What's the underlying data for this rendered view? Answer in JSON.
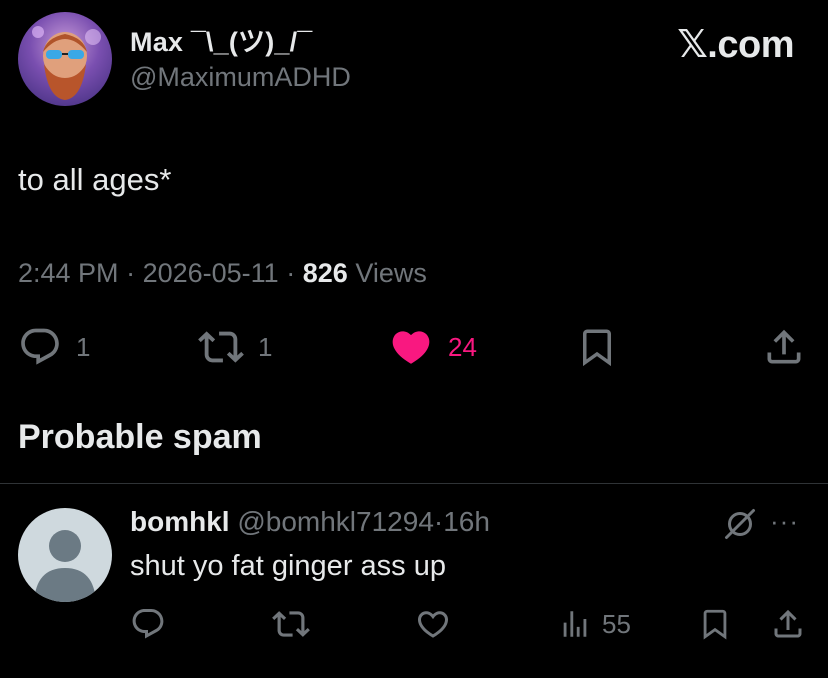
{
  "author": {
    "name": "Max ¯\\_(ツ)_/¯",
    "handle": "@MaximumADHD"
  },
  "brand": "𝕏.com",
  "tweet": {
    "text": "to all ages*",
    "time": "2:44 PM",
    "date": "2026-05-11",
    "views_count": "826",
    "views_label": "Views",
    "sep": "·",
    "replies": "1",
    "reposts": "1",
    "likes": "24"
  },
  "section": {
    "title": "Probable spam"
  },
  "reply": {
    "name": "bomhkl",
    "handle": "@bomhkl71294",
    "sep": "·",
    "age": "16h",
    "text": "shut yo fat ginger ass up",
    "views": "55",
    "more": "···"
  },
  "colors": {
    "like": "#f91880",
    "muted": "#71767b",
    "text": "#e7e9ea",
    "background": "#000000"
  },
  "icons": [
    "reply-icon",
    "repost-icon",
    "like-icon",
    "bookmark-icon",
    "share-icon",
    "views-icon",
    "grok-icon",
    "more-icon"
  ]
}
